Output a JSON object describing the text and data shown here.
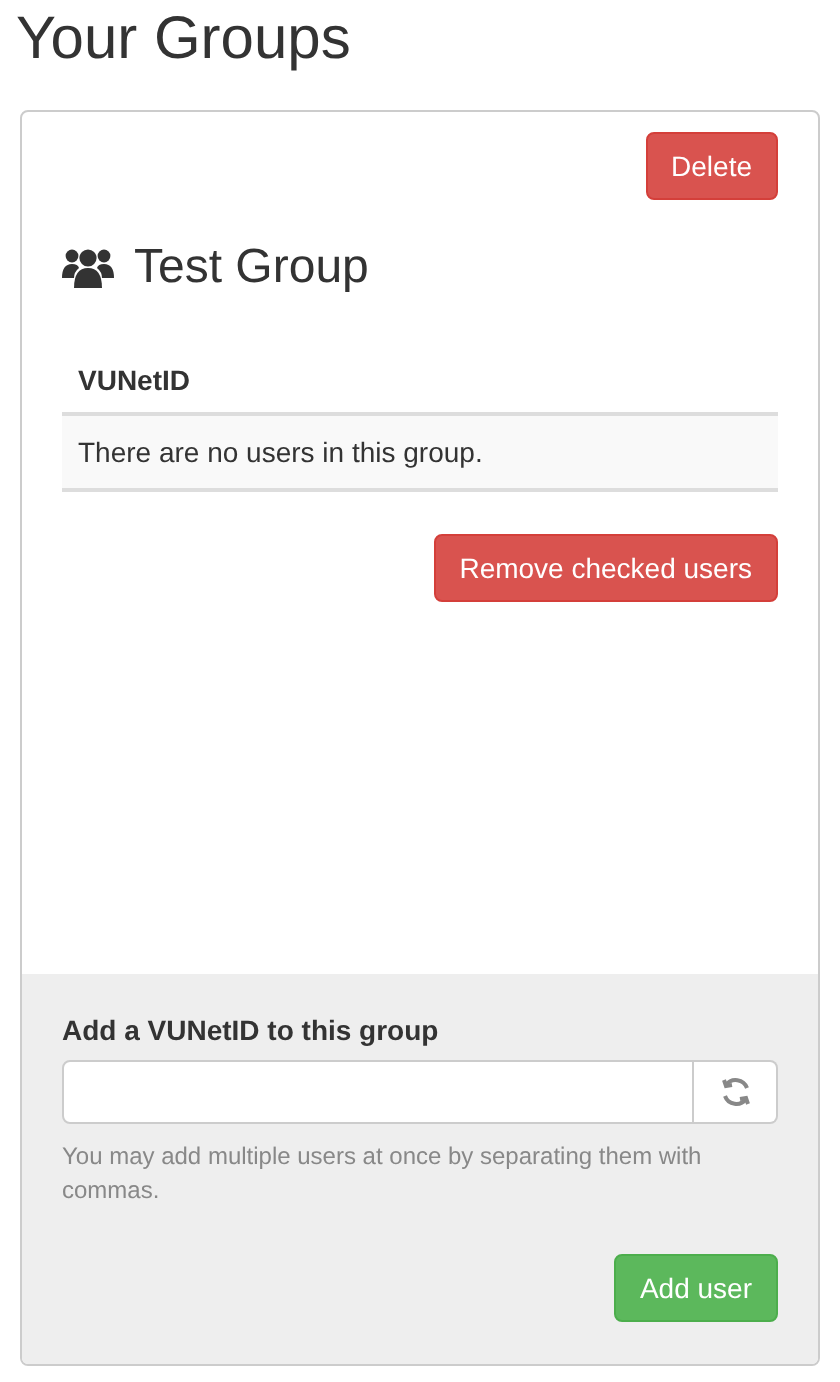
{
  "page": {
    "title": "Your Groups"
  },
  "group": {
    "delete_button": {
      "label": "Delete",
      "kind": "danger"
    },
    "name": "Test Group",
    "table": {
      "columns": [
        "VUNetID"
      ],
      "empty_message": "There are no users in this group."
    },
    "remove_button": {
      "label": "Remove checked users",
      "kind": "danger"
    }
  },
  "add_form": {
    "label": "Add a VUNetID to this group",
    "help": "You may add multiple users at once by separating them with commas.",
    "submit_button": {
      "label": "Add user",
      "kind": "success"
    }
  }
}
